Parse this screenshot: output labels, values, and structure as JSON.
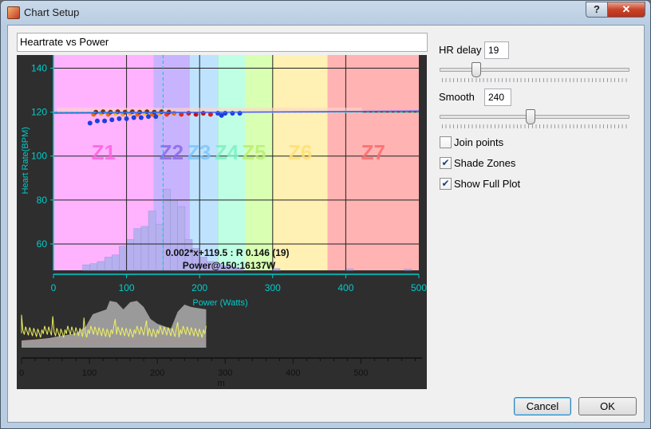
{
  "window": {
    "title": "Chart Setup",
    "help_label": "?",
    "close_label": "✕"
  },
  "chart_title_input": {
    "value": "Heartrate vs Power"
  },
  "controls": {
    "hr_delay": {
      "label": "HR delay",
      "value": "19",
      "slider_position": 0.19
    },
    "smooth": {
      "label": "Smooth",
      "value": "240",
      "slider_position": 0.48
    },
    "join_points": {
      "label": "Join points",
      "checked": false
    },
    "shade_zones": {
      "label": "Shade Zones",
      "checked": true
    },
    "show_full_plot": {
      "label": "Show Full Plot",
      "checked": true
    }
  },
  "buttons": {
    "cancel": "Cancel",
    "ok": "OK"
  },
  "colors": {
    "plot_bg": "#2e2e2e",
    "axis_cyan": "#00cccc",
    "zone_colors": [
      "#ffb3ff",
      "#c8b3ff",
      "#bfe3ff",
      "#bfffe3",
      "#d9ffb3",
      "#fff0b3",
      "#ffb3b3"
    ]
  },
  "chart_data": [
    {
      "type": "scatter",
      "title": "",
      "xlabel": "Power (Watts)",
      "ylabel": "Heart Rate(BPM)",
      "xlim": [
        0,
        500
      ],
      "ylim": [
        48,
        146
      ],
      "x_ticks": [
        "0",
        "100",
        "200",
        "300",
        "400",
        "500"
      ],
      "y_ticks": [
        "60",
        "80",
        "100",
        "120",
        "140"
      ],
      "grid": true,
      "zones": [
        {
          "name": "Z1",
          "from": 0,
          "to": 137
        },
        {
          "name": "Z2",
          "from": 137,
          "to": 186
        },
        {
          "name": "Z3",
          "from": 186,
          "to": 225
        },
        {
          "name": "Z4",
          "from": 225,
          "to": 262
        },
        {
          "name": "Z5",
          "from": 262,
          "to": 300
        },
        {
          "name": "Z6",
          "from": 300,
          "to": 375
        },
        {
          "name": "Z7",
          "from": 375,
          "to": 500
        }
      ],
      "power_histogram": {
        "bin_width": 10,
        "bins": [
          [
            40,
            50.5
          ],
          [
            50,
            51
          ],
          [
            60,
            52
          ],
          [
            70,
            54
          ],
          [
            80,
            55
          ],
          [
            90,
            59
          ],
          [
            100,
            62
          ],
          [
            110,
            67
          ],
          [
            120,
            68
          ],
          [
            130,
            75
          ],
          [
            140,
            69
          ],
          [
            150,
            85
          ],
          [
            160,
            80
          ],
          [
            170,
            77
          ],
          [
            180,
            62
          ],
          [
            190,
            58
          ],
          [
            200,
            54
          ],
          [
            210,
            52
          ],
          [
            220,
            51
          ],
          [
            230,
            50
          ],
          [
            240,
            49.5
          ],
          [
            250,
            49
          ],
          [
            300,
            48.8
          ],
          [
            400,
            48.7
          ],
          [
            480,
            48.6
          ]
        ]
      },
      "points": [
        [
          50,
          115,
          "#1a40d8"
        ],
        [
          60,
          116,
          "#1a40d8"
        ],
        [
          70,
          116,
          "#1a40d8"
        ],
        [
          80,
          116.5,
          "#1a40d8"
        ],
        [
          90,
          117,
          "#1a40d8"
        ],
        [
          100,
          117,
          "#1a40d8"
        ],
        [
          110,
          117.5,
          "#1a40d8"
        ],
        [
          120,
          117.5,
          "#1a40d8"
        ],
        [
          130,
          118,
          "#1a40d8"
        ],
        [
          140,
          118,
          "#1a40d8"
        ],
        [
          55,
          119,
          "#e86a10"
        ],
        [
          65,
          119.5,
          "#f0a020"
        ],
        [
          75,
          119,
          "#e86a10"
        ],
        [
          85,
          119.5,
          "#f0c020"
        ],
        [
          95,
          119,
          "#e8a040"
        ],
        [
          105,
          119.5,
          "#f0a020"
        ],
        [
          115,
          119,
          "#e86a10"
        ],
        [
          125,
          119.5,
          "#f0c020"
        ],
        [
          135,
          119,
          "#e86a10"
        ],
        [
          145,
          119.5,
          "#f0a020"
        ],
        [
          155,
          119,
          "#e84010"
        ],
        [
          165,
          119.5,
          "#e86a10"
        ],
        [
          175,
          119,
          "#d83010"
        ],
        [
          185,
          119.5,
          "#d82010"
        ],
        [
          195,
          119,
          "#c81010"
        ],
        [
          205,
          119.5,
          "#c81010"
        ],
        [
          215,
          119,
          "#d82010"
        ],
        [
          225,
          119.5,
          "#1a40d8"
        ],
        [
          235,
          119.5,
          "#1a40d8"
        ],
        [
          245,
          119.5,
          "#1a40d8"
        ],
        [
          255,
          119.5,
          "#1a40d8"
        ],
        [
          230,
          118.5,
          "#1a40d8"
        ],
        [
          58,
          120,
          "#7a3010"
        ],
        [
          68,
          120.2,
          "#7a3010"
        ],
        [
          78,
          120,
          "#7a3010"
        ],
        [
          88,
          120.2,
          "#7a3010"
        ],
        [
          98,
          120,
          "#7a3010"
        ],
        [
          108,
          120.2,
          "#7a3010"
        ],
        [
          118,
          120,
          "#7a3010"
        ],
        [
          128,
          120.2,
          "#7a3010"
        ],
        [
          138,
          120,
          "#7a3010"
        ],
        [
          148,
          120.2,
          "#7a3010"
        ],
        [
          158,
          120,
          "#7a3010"
        ]
      ],
      "fit_line": {
        "slope": 0.002,
        "intercept": 119.5
      },
      "reference": {
        "power": 150,
        "hr": 120
      },
      "annotations": [
        "0.002*x+119.5 : R 0.146 (19)",
        "Power@150:16137W"
      ]
    },
    {
      "type": "area",
      "title": "",
      "xlabel": "m",
      "ylabel": "",
      "xlim": [
        0,
        590
      ],
      "x_ticks": [
        "0",
        "100",
        "200",
        "300",
        "400",
        "500"
      ],
      "altitude_profile": [
        [
          0,
          0.15
        ],
        [
          20,
          0.17
        ],
        [
          40,
          0.2
        ],
        [
          60,
          0.25
        ],
        [
          80,
          0.3
        ],
        [
          95,
          0.45
        ],
        [
          105,
          0.7
        ],
        [
          115,
          0.75
        ],
        [
          125,
          0.8
        ],
        [
          130,
          0.98
        ],
        [
          140,
          0.95
        ],
        [
          150,
          0.8
        ],
        [
          160,
          0.95
        ],
        [
          170,
          0.98
        ],
        [
          180,
          0.85
        ],
        [
          190,
          0.6
        ],
        [
          200,
          0.5
        ],
        [
          210,
          0.45
        ],
        [
          220,
          0.4
        ],
        [
          230,
          0.75
        ],
        [
          240,
          0.9
        ],
        [
          250,
          0.85
        ],
        [
          272,
          0.8
        ]
      ]
    }
  ]
}
